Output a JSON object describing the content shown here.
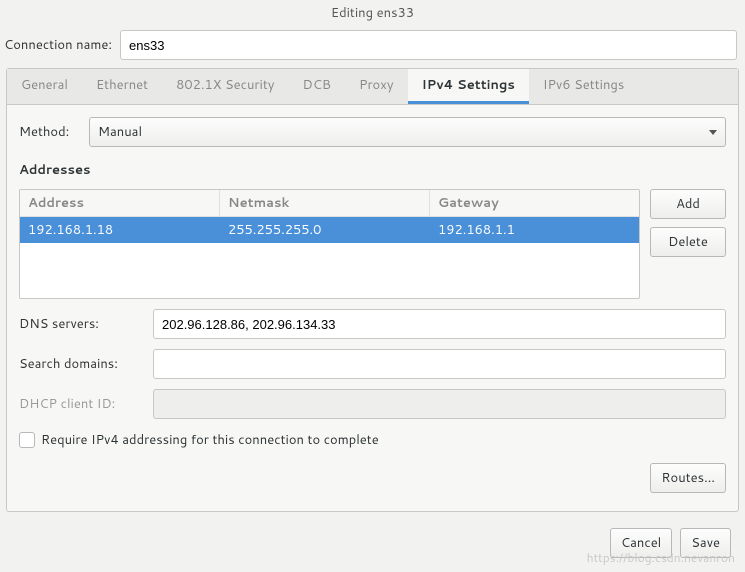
{
  "window": {
    "title": "Editing ens33"
  },
  "name": {
    "label": "Connection name:",
    "value": "ens33"
  },
  "tabs": [
    {
      "label": "General"
    },
    {
      "label": "Ethernet"
    },
    {
      "label": "802.1X Security"
    },
    {
      "label": "DCB"
    },
    {
      "label": "Proxy"
    },
    {
      "label": "IPv4 Settings"
    },
    {
      "label": "IPv6 Settings"
    }
  ],
  "active_tab": "IPv4 Settings",
  "method": {
    "label": "Method:",
    "value": "Manual"
  },
  "addresses": {
    "section_label": "Addresses",
    "headers": {
      "address": "Address",
      "netmask": "Netmask",
      "gateway": "Gateway"
    },
    "rows": [
      {
        "address": "192.168.1.18",
        "netmask": "255.255.255.0",
        "gateway": "192.168.1.1",
        "selected": true
      }
    ],
    "buttons": {
      "add": "Add",
      "delete": "Delete"
    }
  },
  "dns": {
    "label": "DNS servers:",
    "value": "202.96.128.86, 202.96.134.33"
  },
  "search": {
    "label": "Search domains:",
    "value": ""
  },
  "dhcp": {
    "label": "DHCP client ID:",
    "value": "",
    "disabled": true
  },
  "require": {
    "label": "Require IPv4 addressing for this connection to complete",
    "checked": false
  },
  "routes_button": "Routes…",
  "footer": {
    "cancel": "Cancel",
    "save": "Save"
  },
  "watermark": "https://blog.csdn.nevanron"
}
